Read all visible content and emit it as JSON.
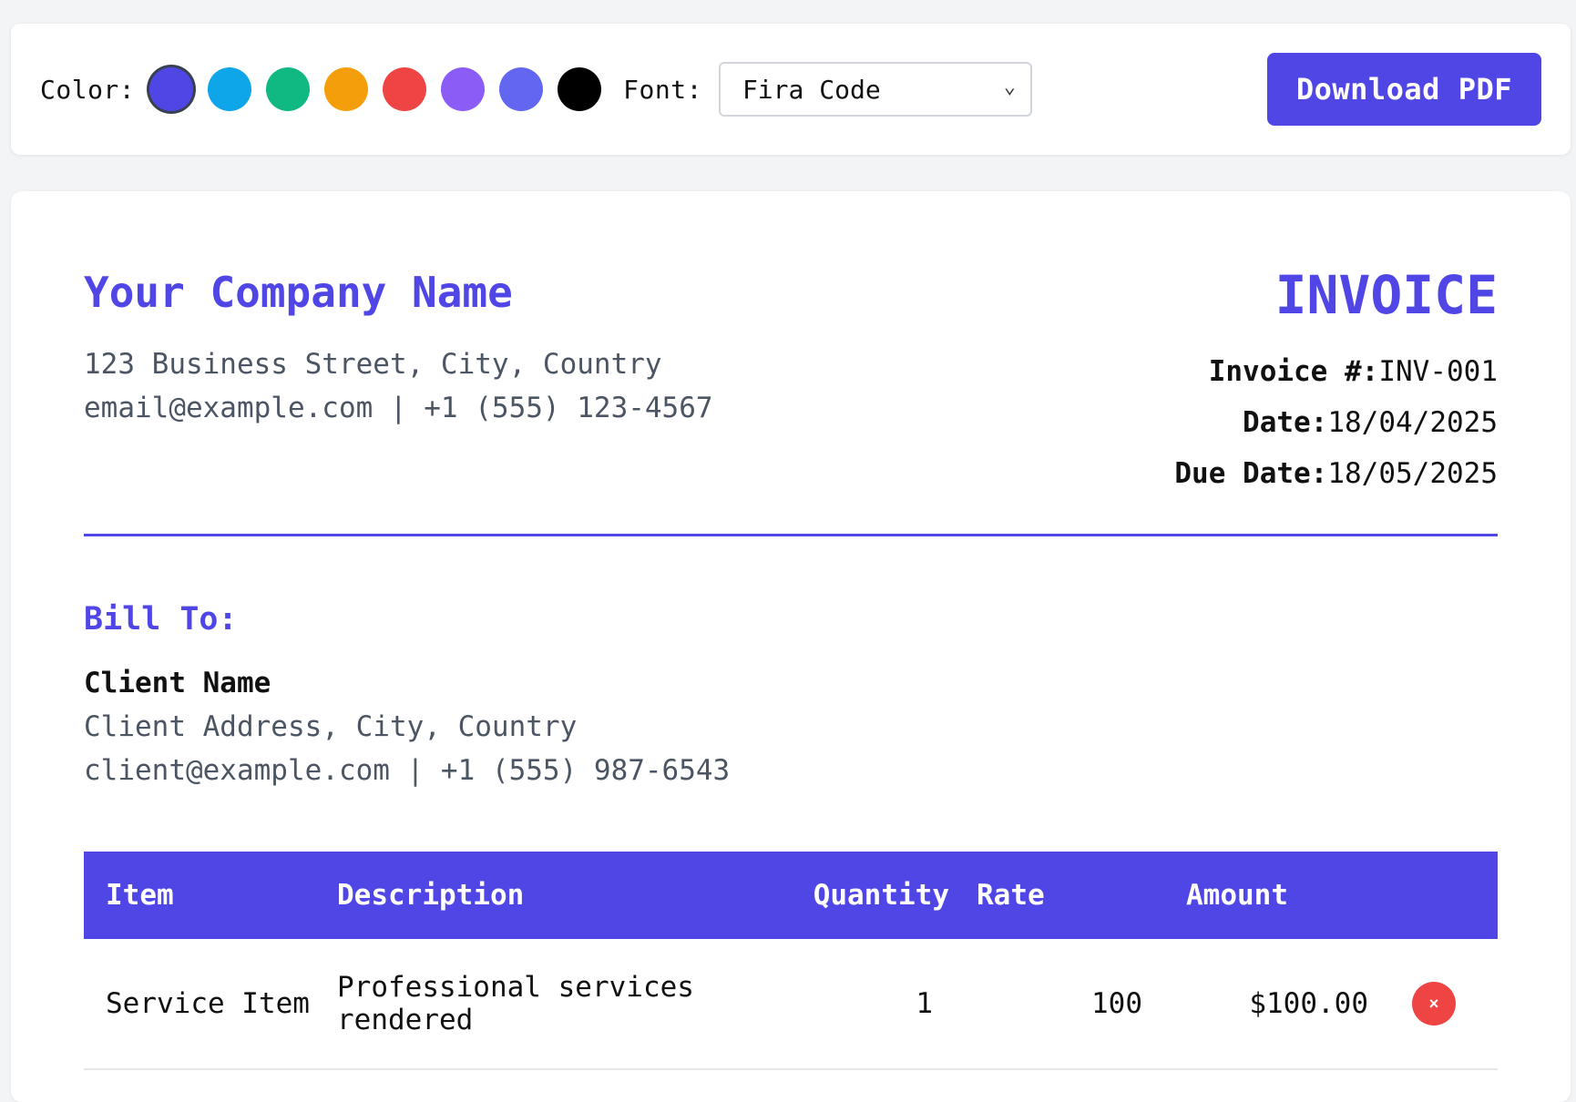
{
  "toolbar": {
    "color_label": "Color:",
    "colors": [
      "#4f46e5",
      "#0ea5e9",
      "#10b981",
      "#f59e0b",
      "#ef4444",
      "#8b5cf6",
      "#6366f1",
      "#000000"
    ],
    "selected_color": "#4f46e5",
    "font_label": "Font:",
    "font_value": "Fira Code",
    "download_label": "Download PDF"
  },
  "invoice": {
    "company_name": "Your Company Name",
    "company_address": "123 Business Street, City, Country",
    "company_contact": "email@example.com | +1 (555) 123-4567",
    "title": "INVOICE",
    "number_label": "Invoice #:",
    "number_value": "INV-001",
    "date_label": "Date:",
    "date_value": "18/04/2025",
    "due_label": "Due Date:",
    "due_value": "18/05/2025",
    "bill_to_title": "Bill To:",
    "client_name": "Client Name",
    "client_address": "Client Address, City, Country",
    "client_contact": "client@example.com | +1 (555) 987-6543"
  },
  "table": {
    "headers": {
      "item": "Item",
      "description": "Description",
      "quantity": "Quantity",
      "rate": "Rate",
      "amount": "Amount"
    },
    "rows": [
      {
        "item": "Service Item",
        "description": "Professional services rendered",
        "quantity": "1",
        "rate": "100",
        "amount": "$100.00",
        "remove_icon": "×"
      }
    ]
  }
}
